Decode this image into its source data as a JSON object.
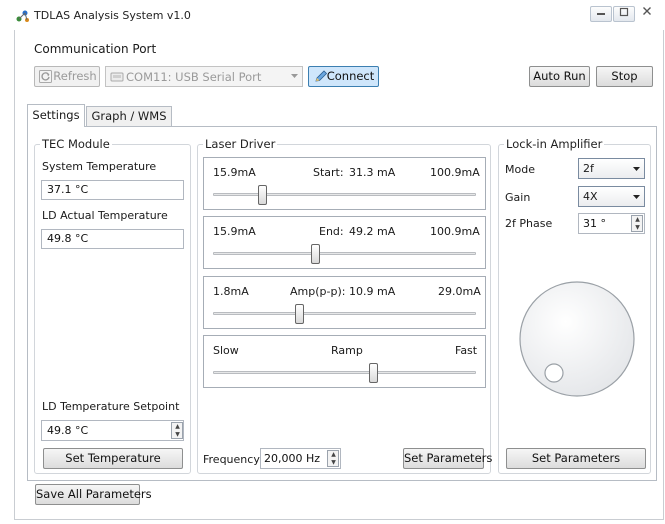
{
  "window": {
    "title": "TDLAS Analysis System v1.0"
  },
  "comm": {
    "group_label": "Communication Port",
    "refresh_label": "Refresh",
    "port_value": "COM11: USB Serial Port",
    "connect_label": "Connect",
    "autorun_label": "Auto Run",
    "stop_label": "Stop"
  },
  "tabs": [
    {
      "label": "Settings"
    },
    {
      "label": "Graph / WMS"
    }
  ],
  "tec": {
    "group_label": "TEC Module",
    "sys_temp_label": "System Temperature",
    "sys_temp_value": "37.1 °C",
    "ld_temp_label": "LD Actual Temperature",
    "ld_temp_value": "49.8 °C",
    "setpoint_label": "LD Temperature Setpoint",
    "setpoint_value": "49.8 °C",
    "set_button": "Set Temperature"
  },
  "laser": {
    "group_label": "Laser Driver",
    "sliders": [
      {
        "min": "15.9mA",
        "caption": "Start:",
        "value": "31.3 mA",
        "max": "100.9mA",
        "fraction": 0.19
      },
      {
        "min": "15.9mA",
        "caption": "End:",
        "value": "49.2 mA",
        "max": "100.9mA",
        "fraction": 0.39
      },
      {
        "min": "1.8mA",
        "caption": "Amp(p-p):",
        "value": "10.9 mA",
        "max": "29.0mA",
        "fraction": 0.33
      },
      {
        "min": "Slow",
        "caption": "Ramp",
        "value": "",
        "max": "Fast",
        "fraction": 0.61
      }
    ],
    "freq_label": "Frequency",
    "freq_value": "20,000 Hz",
    "set_button": "Set Parameters"
  },
  "lockin": {
    "group_label": "Lock-in Amplifier",
    "mode_label": "Mode",
    "mode_value": "2f",
    "gain_label": "Gain",
    "gain_value": "4X",
    "phase_label": "2f Phase",
    "phase_value": "31 °",
    "set_button": "Set Parameters"
  },
  "save_all_label": "Save All Parameters",
  "colors": {
    "connect_bg": "#cfe6fb",
    "connect_border": "#3c7fb1",
    "active_tab": "#ffffff"
  },
  "icons": {
    "app": "app-icon",
    "refresh": "refresh-icon",
    "port": "serial-port-icon",
    "connect": "pencil-icon"
  }
}
